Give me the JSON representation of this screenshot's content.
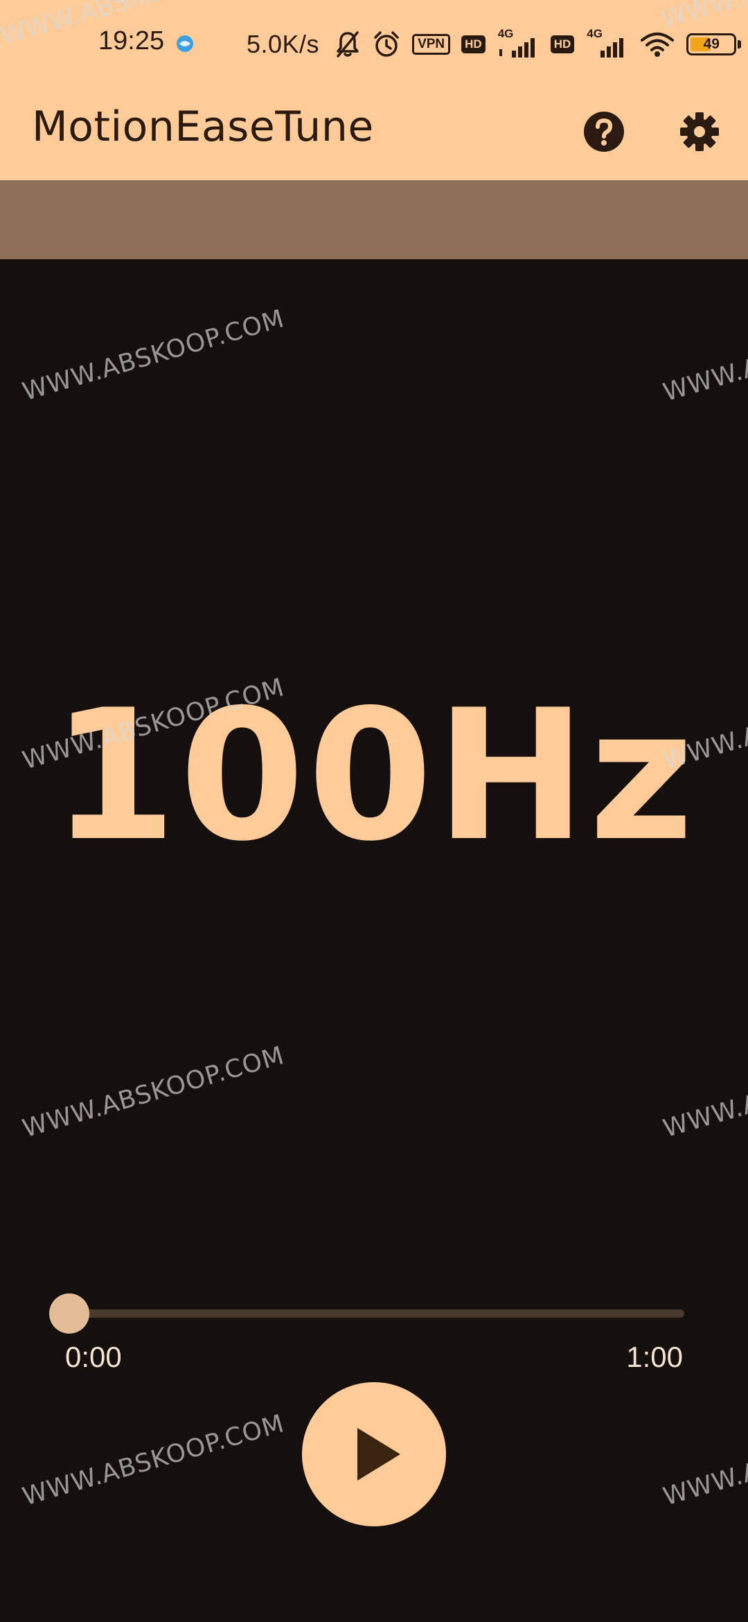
{
  "status_bar": {
    "time": "19:25",
    "net_speed": "5.0K/s",
    "vpn_label": "VPN",
    "hd_label": "HD",
    "network_type": "4G",
    "battery_level": "49",
    "battery_fraction": 0.49,
    "icons": [
      "browser-icon",
      "bell-off-icon",
      "alarm-icon",
      "signal-icon",
      "wifi-icon",
      "battery-icon"
    ]
  },
  "app_bar": {
    "title": "MotionEaseTune",
    "actions": [
      "help-icon",
      "settings-icon"
    ]
  },
  "main": {
    "frequency": "100Hz"
  },
  "player": {
    "elapsed": "0:00",
    "total": "1:00",
    "progress": 0.0,
    "play_icon": "play-icon"
  },
  "watermark": {
    "text": "WWW.ABSKOOP.COM"
  },
  "colors": {
    "accent": "#ffcc99",
    "subbar": "#8c7055",
    "background": "#15100d",
    "on_accent": "#2a1a10"
  }
}
